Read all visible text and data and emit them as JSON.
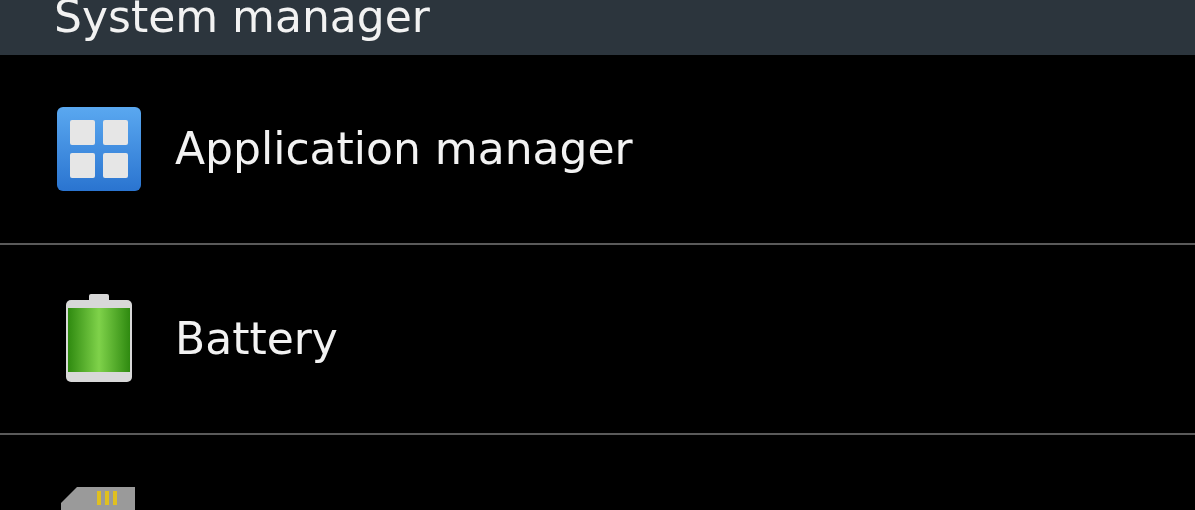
{
  "header": {
    "title": "System manager"
  },
  "items": [
    {
      "kind": "apps",
      "label": "Application manager"
    },
    {
      "kind": "battery",
      "label": "Battery"
    },
    {
      "kind": "storage"
    }
  ]
}
